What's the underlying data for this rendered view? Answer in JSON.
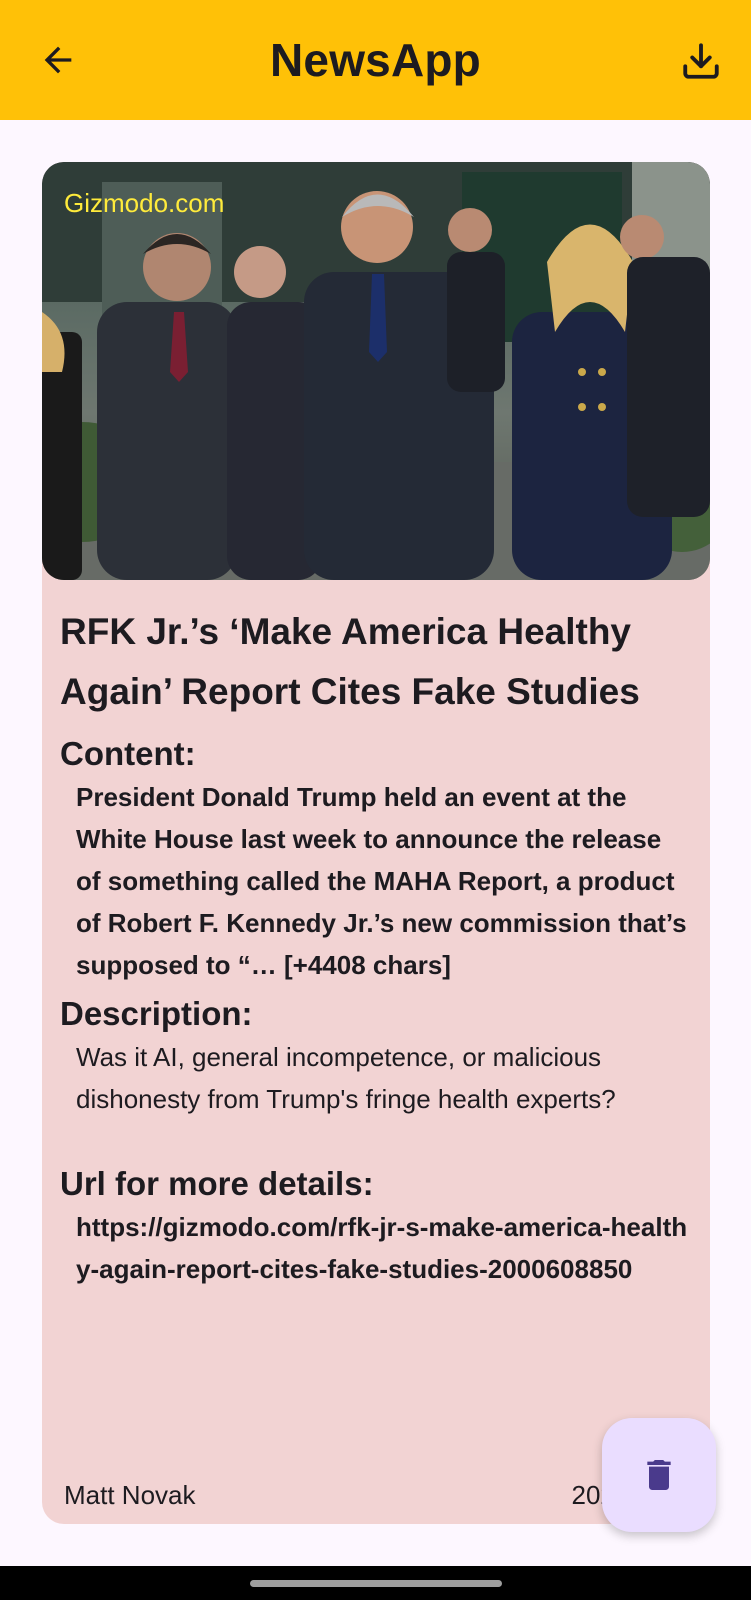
{
  "appbar": {
    "title": "NewsApp",
    "back_icon": "arrow-back-icon",
    "download_icon": "download-icon"
  },
  "article": {
    "source": "Gizmodo.com",
    "title": "RFK Jr.’s ‘Make America Healthy Again’ Report Cites Fake Studies",
    "content_label": "Content:",
    "content": "President Donald Trump held an event at the White House last week to announce the release of something called the MAHA Report, a product of Robert F. Kennedy Jr.’s new commission that’s supposed to “… [+4408 chars]",
    "description_label": "Description:",
    "description": "Was it AI, general incompetence, or malicious dishonesty from Trump's fringe health experts?",
    "url_label": "Url for more details:",
    "url": "https://gizmodo.com/rfk-jr-s-make-america-healthy-again-report-cites-fake-studies-2000608850",
    "author": "Matt Novak",
    "date": "2025-"
  },
  "fab": {
    "icon": "delete-icon"
  },
  "colors": {
    "appbar": "#ffc107",
    "card": "#f2d3d3",
    "source_text": "#ffeb3b",
    "fab": "#eaddff",
    "fab_icon": "#4a3a8c"
  }
}
